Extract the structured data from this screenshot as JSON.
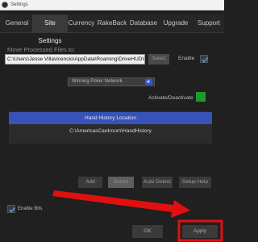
{
  "window": {
    "title": "Settings"
  },
  "tabs": [
    {
      "label": "General"
    },
    {
      "label": "Site Settings"
    },
    {
      "label": "Currency"
    },
    {
      "label": "RakeBack"
    },
    {
      "label": "Database"
    },
    {
      "label": "Upgrade"
    },
    {
      "label": "Support"
    }
  ],
  "site_settings": {
    "move_label": "Move Processed Files to:",
    "move_path": "C:\\Users\\Jesse Villavicencio\\AppData\\Roaming\\DriveHUD\\Processed\\",
    "select_label": "Select",
    "enable_label": "Enable",
    "enable_checked": true,
    "network_value": "Winning Poker Network",
    "activate_label": "Activate/Deactivate",
    "activate_color": "#1e9a28",
    "hand_history_header": "Hand History Location",
    "hand_history_rows": [
      "C:\\AmericasCardroom\\HandHistory"
    ],
    "buttons": {
      "add": "Add",
      "delete": "Delete",
      "auto_detect": "Auto Detect",
      "setup_help": "Setup Help"
    }
  },
  "footer": {
    "enable_bits_label": "Enable Bits",
    "enable_bits_checked": true,
    "ok_label": "OK",
    "apply_label": "Apply"
  },
  "annotation_color": "#e01010"
}
